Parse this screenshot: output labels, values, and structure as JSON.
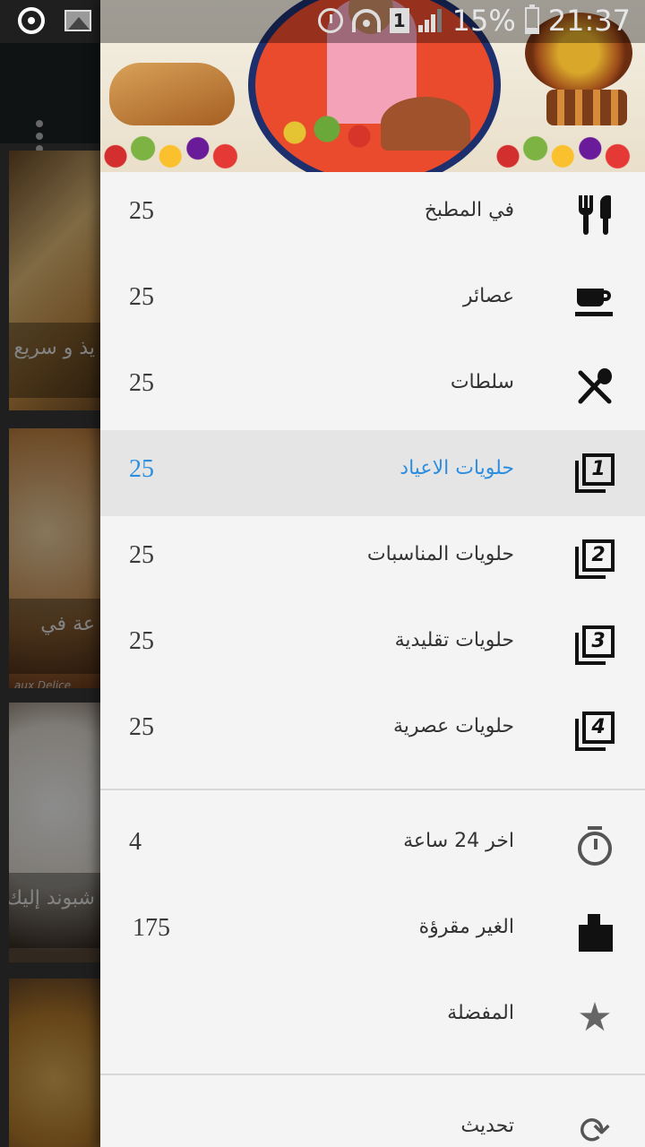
{
  "status_bar": {
    "battery": "15%",
    "time": "21:37",
    "sim_label": "1"
  },
  "background": {
    "captions": [
      "يذ و سريع",
      "عة في",
      "شبوند إليك"
    ],
    "watermark": "aux Delice"
  },
  "drawer": {
    "categories": [
      {
        "label": "في المطبخ",
        "count": "25",
        "icon": "utensils-icon"
      },
      {
        "label": "عصائر",
        "count": "25",
        "icon": "cup-icon"
      },
      {
        "label": "سلطات",
        "count": "25",
        "icon": "salad-icon"
      },
      {
        "label": "حلويات الاعياد",
        "count": "25",
        "icon": "filter-1-icon",
        "active": true
      },
      {
        "label": "حلويات المناسبات",
        "count": "25",
        "icon": "filter-2-icon"
      },
      {
        "label": "حلويات تقليدية",
        "count": "25",
        "icon": "filter-3-icon"
      },
      {
        "label": "حلويات عصرية",
        "count": "25",
        "icon": "filter-4-icon"
      }
    ],
    "secondary": [
      {
        "label": "اخر 24 ساعة",
        "count": "4",
        "icon": "timer-icon"
      },
      {
        "label": "الغير مقرؤة",
        "count": "175",
        "icon": "unread-icon"
      },
      {
        "label": "المفضلة",
        "count": "",
        "icon": "star-icon"
      }
    ],
    "actions": [
      {
        "label": "تحديث",
        "icon": "refresh-icon"
      }
    ]
  },
  "colors": {
    "active_text": "#2d8ee0",
    "drawer_bg": "#f4f4f4",
    "active_bg": "#e5e5e5",
    "toolbar": "#1d2326"
  }
}
